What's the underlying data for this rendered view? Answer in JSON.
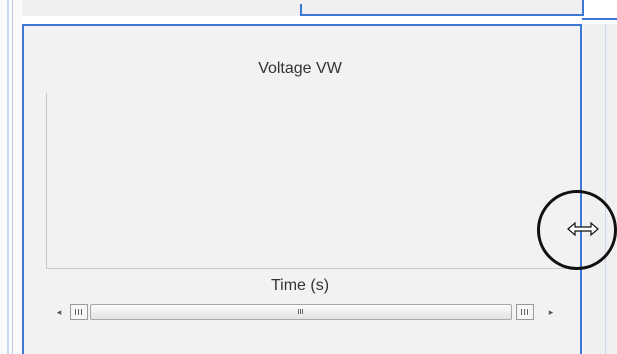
{
  "plot": {
    "title": "Voltage VW",
    "xlabel": "Time (s)"
  },
  "scrollbar": {
    "left_arrow_icon": "left-arrow-icon",
    "right_arrow_icon": "right-arrow-icon"
  },
  "cursor": {
    "type": "horizontal-resize-icon"
  },
  "colors": {
    "accent_border": "#3c78d8",
    "panel_background": "#f2f2f2",
    "highlight_circle": "#111111"
  }
}
